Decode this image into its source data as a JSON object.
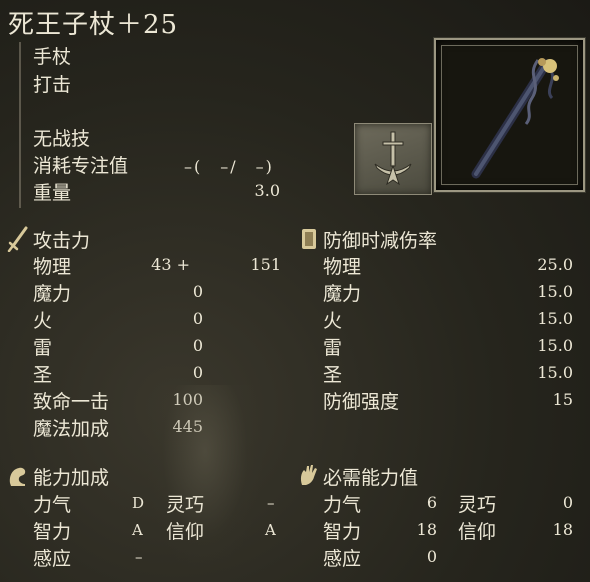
{
  "weapon": {
    "name": "死王子杖＋25",
    "type": "手杖",
    "attack_type": "打击",
    "skill": "无战技",
    "fp_cost_label": "消耗专注值",
    "fp_cost_value": "–(　–/　–)",
    "weight_label": "重量",
    "weight_value": "3.0"
  },
  "attack_power": {
    "title": "攻击力",
    "rows": [
      {
        "label": "物理",
        "base": "43 +",
        "extra": "151"
      },
      {
        "label": "魔力",
        "base": "0"
      },
      {
        "label": "火",
        "base": "0"
      },
      {
        "label": "雷",
        "base": "0"
      },
      {
        "label": "圣",
        "base": "0"
      },
      {
        "label": "致命一击",
        "base": "100"
      },
      {
        "label": "魔法加成",
        "base": "445"
      }
    ]
  },
  "guarded_negation": {
    "title": "防御时减伤率",
    "rows": [
      {
        "label": "物理",
        "value": "25.0"
      },
      {
        "label": "魔力",
        "value": "15.0"
      },
      {
        "label": "火",
        "value": "15.0"
      },
      {
        "label": "雷",
        "value": "15.0"
      },
      {
        "label": "圣",
        "value": "15.0"
      },
      {
        "label": "防御强度",
        "value": "15"
      }
    ]
  },
  "scaling": {
    "title": "能力加成",
    "str_label": "力气",
    "str": "D",
    "dex_label": "灵巧",
    "dex": "–",
    "int_label": "智力",
    "int": "A",
    "fai_label": "信仰",
    "fai": "A",
    "arc_label": "感应",
    "arc": "–"
  },
  "requirements": {
    "title": "必需能力值",
    "str_label": "力气",
    "str": "6",
    "dex_label": "灵巧",
    "dex": "0",
    "int_label": "智力",
    "int": "18",
    "fai_label": "信仰",
    "fai": "18",
    "arc_label": "感应",
    "arc": "0"
  },
  "icons": {
    "attack": "sword-icon",
    "guard": "shield-icon",
    "scaling": "arm-icon",
    "requirements": "hand-icon",
    "affinity": "sword-emblem-icon",
    "weapon": "staff-icon"
  },
  "colors": {
    "text": "#ece7d5",
    "frame": "#9c9782",
    "background": "#26251d"
  }
}
